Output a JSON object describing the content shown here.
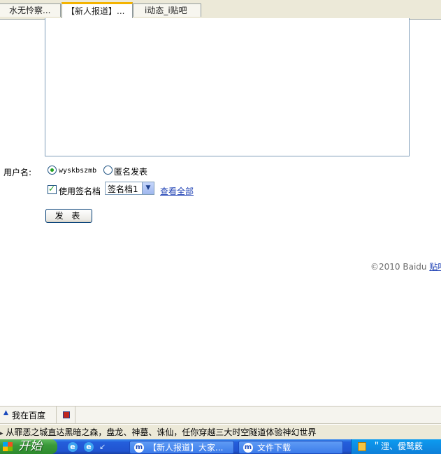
{
  "tabs": [
    {
      "label": "水无怜察..."
    },
    {
      "label": "【新人报道】..."
    },
    {
      "label": "i动态_i贴吧"
    }
  ],
  "form": {
    "username_label": "用户名:",
    "username_value": "wyskbszmb",
    "anonymous_label": "匿名发表",
    "signature_label": "使用签名档",
    "signature_select": "签名档1",
    "view_all_link": "查看全部",
    "submit_label": "发 表"
  },
  "footer": {
    "copyright": "©2010 Baidu",
    "tieba_link": "贴吧"
  },
  "toolbar": {
    "baidu_label": "我在百度"
  },
  "status_text": "从罪恶之城直达黑暗之森，盘龙、神墓、诛仙，任你穿越三大时空隧道体验神幻世界",
  "taskbar": {
    "start_label": "开始",
    "tasks": [
      {
        "label": "【新人报道】大家..."
      },
      {
        "label": "文件下载"
      }
    ],
    "tray_label": "＂浬、僾鹥薮"
  },
  "colors": {
    "link": "#2143b5",
    "radio_checked": "#21a121",
    "active_tab_accent": "#f4b300",
    "taskbar": "#245edb"
  }
}
